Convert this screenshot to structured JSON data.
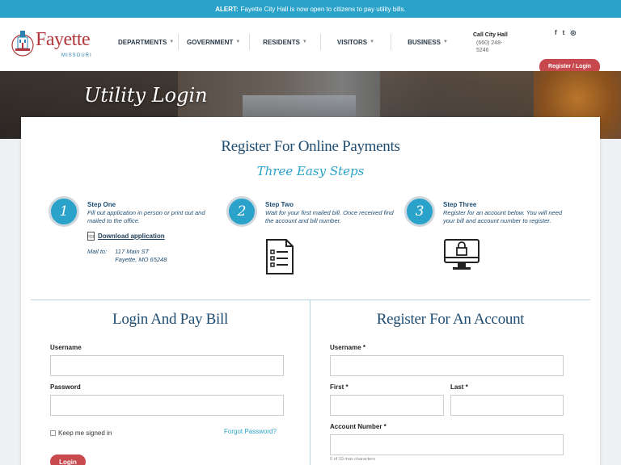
{
  "alert": {
    "label": "ALERT:",
    "text": "Fayette City Hall is now open to citizens to pay utility bills."
  },
  "logo": {
    "word": "Fayette",
    "sub": "MISSOURI"
  },
  "nav": [
    {
      "label": "DEPARTMENTS"
    },
    {
      "label": "GOVERNMENT"
    },
    {
      "label": "RESIDENTS"
    },
    {
      "label": "VISITORS"
    },
    {
      "label": "BUSINESS"
    }
  ],
  "city_hall": {
    "title": "Call City Hall",
    "phone": "(660) 248-5246"
  },
  "social": {
    "facebook": "f",
    "twitter": "t",
    "instagram": "◎"
  },
  "header_button": "Register / Login",
  "hero_title": "Utility Login",
  "card": {
    "title": "Register For Online Payments",
    "subtitle": "Three Easy Steps",
    "steps": [
      {
        "number": "1",
        "title": "Step One",
        "desc": "Fill out application in person or print out and mailed to the office.",
        "download": "Download application",
        "mail_label": "Mail to:",
        "mail_line1": "117 Main ST",
        "mail_line2": "Fayette, MO 65248"
      },
      {
        "number": "2",
        "title": "Step Two",
        "desc": "Wait for your first mailed bill. Once received find the account and bill number."
      },
      {
        "number": "3",
        "title": "Step Three",
        "desc": "Register for an account below. You will need your bill and account number to register."
      }
    ]
  },
  "login": {
    "title": "Login And Pay Bill",
    "username_label": "Username",
    "password_label": "Password",
    "remember": "Keep me signed in",
    "forgot": "Forgot Password?",
    "button": "Login"
  },
  "register": {
    "title": "Register For An Account",
    "username_label": "Username *",
    "first_label": "First *",
    "last_label": "Last *",
    "account_label": "Account Number *",
    "account_note": "0 of 10 max characters"
  }
}
